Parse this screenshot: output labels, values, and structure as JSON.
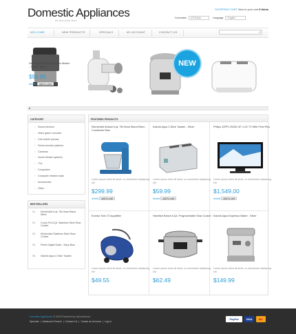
{
  "header": {
    "logo_title": "Domestic Appliances",
    "logo_tagline": "the best online store",
    "cart_label": "SHOPPING CART",
    "cart_text": "Now in your cart",
    "cart_items": "0 items",
    "currencies_label": "Currencies",
    "currency_value": "US Dollar",
    "language_label": "Language",
    "language_value": "English"
  },
  "nav": {
    "items": [
      "WELCOME",
      "NEW PRODUCTS",
      "SPECIALS",
      "MY ACCOUNT",
      "CONTACT US"
    ],
    "active": "WELCOME",
    "search_placeholder": ""
  },
  "slider": {
    "title": "Delonghi EC410 Espresso Maker - Silver / Black",
    "price": "$99.99",
    "details": "details",
    "add_to_cart": "add to cart",
    "badge": "NEW"
  },
  "left": {
    "categories_title": "CATEGORY",
    "categories": [
      "Sound devices",
      "Video game consoles",
      "Cell mobile phones",
      "Home security systems",
      "Cameras",
      "Home theater systems",
      "TVs",
      "Computers",
      "Computer related music",
      "Accessories",
      "Other"
    ],
    "bestsellers_title": "BESTSELLERS",
    "bestsellers": [
      {
        "n": "01.",
        "name": "KitchenAid 5-qt. Tilt-Head Stand Mixer"
      },
      {
        "n": "02.",
        "name": "Crock-Pot 6-Qt. Stainless Steel Slow Cooker"
      },
      {
        "n": "03.",
        "name": "KitchenAid Stainless Steel Slow Cooker"
      },
      {
        "n": "04.",
        "name": "Prime Digital Scale - Navy Blue"
      },
      {
        "n": "05.",
        "name": "Kalorik Aqua 2-Slice Toaster"
      }
    ]
  },
  "featured": {
    "title": "FEATURED PRODUCTS",
    "desc": "Lorem ipsum dolor sit amet, co nsectetuer adipiscing elit",
    "details": "details",
    "add_to_cart": "add to cart",
    "products": [
      {
        "name": "KitchenAid Artisan 5-qt. Tilt-Head Stand Mixer - Cornflower Blue",
        "price": "$299.99",
        "icon": "stand-mixer"
      },
      {
        "name": "Kalorik Aqua 2-Slice Toaster - Silver",
        "price": "$59.99",
        "icon": "toaster"
      },
      {
        "name": "Philips 32PFL7603D 32\" LCD TV With Pixel Plus",
        "price": "$1,549.00",
        "icon": "lcd-tv"
      },
      {
        "name": "Eureka Twin 72 Aquafilter",
        "price": "$49.55",
        "icon": "vacuum"
      },
      {
        "name": "Hamilton Beach 6-Qt. Programmable Slow Cooker",
        "price": "$62.49",
        "icon": "slow-cooker"
      },
      {
        "name": "Kalorik Aqua Espresso Maker - Silver",
        "price": "$149.99",
        "icon": "espresso-maker"
      }
    ]
  },
  "footer": {
    "brand": "Domestic Appliances",
    "copyright": "© 2010",
    "powered": "Powered by osCommerce",
    "links": [
      "Specials",
      "Advanced Search",
      "Contact Us",
      "Create an Account",
      "Log In"
    ],
    "payments": [
      "PayPal",
      "VISA",
      "MC"
    ]
  },
  "colors": {
    "accent": "#2b9bd6",
    "footer_bg": "#2e2e2e"
  }
}
